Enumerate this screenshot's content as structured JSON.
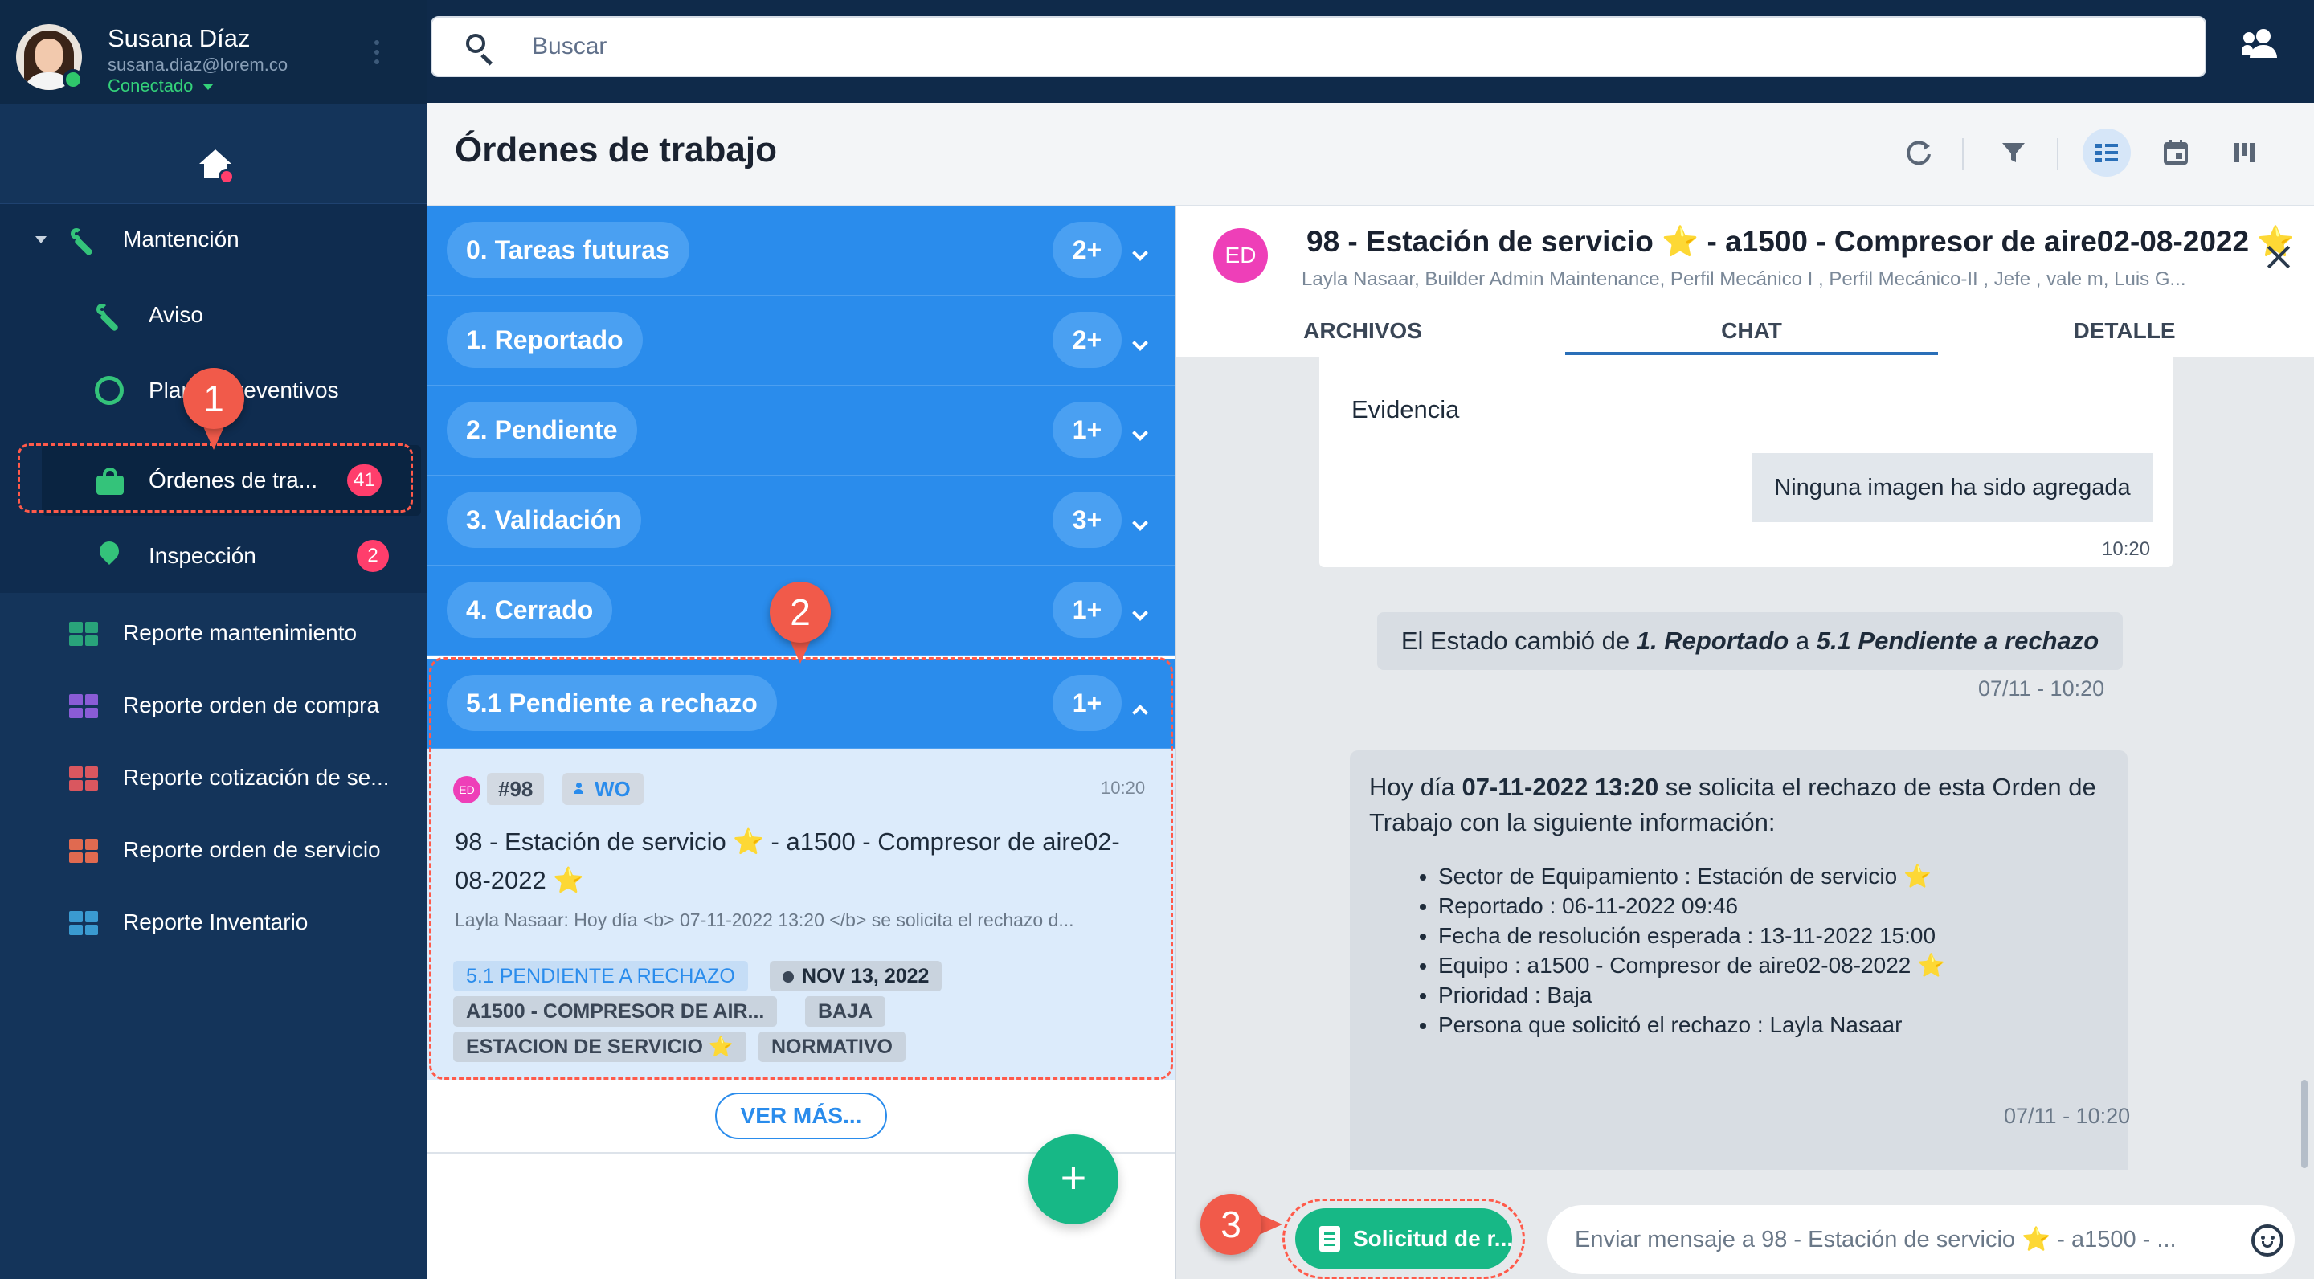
{
  "user": {
    "name": "Susana Díaz",
    "email": "susana.diaz@lorem.co",
    "status": "Conectado"
  },
  "sidebar": {
    "group_label": "Mantención",
    "items": [
      {
        "label": "Aviso"
      },
      {
        "label": "Planes preventivos"
      },
      {
        "label": "Órdenes de tra...",
        "badge": "41"
      },
      {
        "label": "Inspección",
        "badge": "2"
      }
    ],
    "reports": [
      {
        "label": "Reporte mantenimiento",
        "color": "#29a37a"
      },
      {
        "label": "Reporte orden de compra",
        "color": "#8a5cd6"
      },
      {
        "label": "Reporte cotización de se...",
        "color": "#d9575f"
      },
      {
        "label": "Reporte orden de servicio",
        "color": "#e06a50"
      },
      {
        "label": "Reporte Inventario",
        "color": "#3a9ad0"
      }
    ]
  },
  "search": {
    "placeholder": "Buscar"
  },
  "page": {
    "title": "Órdenes de trabajo"
  },
  "statuses": [
    {
      "label": "0. Tareas futuras",
      "count": "2+"
    },
    {
      "label": "1. Reportado",
      "count": "2+"
    },
    {
      "label": "2. Pendiente",
      "count": "1+"
    },
    {
      "label": "3. Validación",
      "count": "3+"
    },
    {
      "label": "4. Cerrado",
      "count": "1+"
    },
    {
      "label": "5.1 Pendiente a rechazo",
      "count": "1+"
    }
  ],
  "card": {
    "avatar": "ED",
    "number": "#98",
    "type": "WO",
    "time": "10:20",
    "title": "98 - Estación de servicio ⭐ - a1500 - Compresor de aire02-08-2022 ⭐",
    "preview": "Layla Nasaar: Hoy día <b> 07-11-2022 13:20 </b> se solicita el rechazo d...",
    "chips": {
      "status": "5.1 PENDIENTE A RECHAZO",
      "date": "NOV 13, 2022",
      "equipment": "A1500 - COMPRESOR DE AIR...",
      "priority": "BAJA",
      "location": "ESTACION DE SERVICIO ⭐",
      "category": "NORMATIVO"
    },
    "more_label": "VER MÁS..."
  },
  "chat": {
    "avatar": "ED",
    "title": "98 - Estación de servicio ⭐ - a1500 - Compresor de aire02-08-2022 ⭐",
    "participants": "Layla Nasaar, Builder Admin Maintenance, Perfil Mecánico I , Perfil Mecánico-II , Jefe , vale m, Luis G...",
    "tabs": {
      "files": "ARCHIVOS",
      "chat": "CHAT",
      "detail": "DETALLE"
    },
    "evidence_label": "Evidencia",
    "no_image": "Ninguna imagen ha sido agregada",
    "evidence_time": "10:20",
    "status_change": {
      "prefix": "El Estado cambió de ",
      "from": "1. Reportado",
      "mid": " a ",
      "to": "5.1 Pendiente a rechazo",
      "time": "07/11 - 10:20"
    },
    "request": {
      "intro_prefix": "Hoy día ",
      "intro_date": "07-11-2022 13:20",
      "intro_suffix": " se solicita el rechazo de esta Orden de Trabajo con la siguiente información:",
      "items": [
        "Sector de Equipamiento : Estación de servicio ⭐",
        "Reportado : 06-11-2022 09:46",
        "Fecha de resolución esperada : 13-11-2022 15:00",
        "Equipo : a1500 - Compresor de aire02-08-2022 ⭐",
        "Prioridad : Baja",
        "Persona que solicitó el rechazo : Layla Nasaar"
      ],
      "time": "07/11 - 10:20"
    },
    "request_button": "Solicitud de r...",
    "input_placeholder": "Enviar mensaje a 98 - Estación de servicio ⭐ - a1500 - ..."
  },
  "callouts": [
    "1",
    "2",
    "3"
  ],
  "colors": {
    "accent_blue": "#2a8cec",
    "green": "#17b886",
    "badge_pink": "#ff3e6c",
    "sidebar_bg": "#14345a"
  }
}
